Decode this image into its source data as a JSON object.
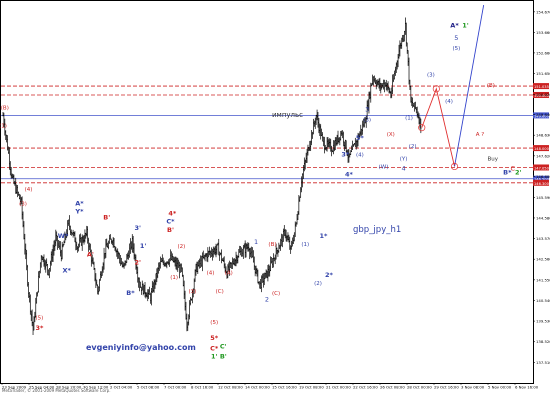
{
  "chart_data": {
    "type": "candlestick",
    "symbol_label": "gbp_jpy_h1",
    "email": "evgeniyinfo@yahoo.com",
    "footer": "MetaTrader, © 2001-2009 MetaQuotes Software Corp.",
    "impulse_label": "импульс",
    "buy_label": "Buy",
    "ylim": [
      136.5,
      155.2
    ],
    "price_ticks": [
      {
        "text": "154.670",
        "value": 154.67
      },
      {
        "text": "153.660",
        "value": 153.66
      },
      {
        "text": "152.660",
        "value": 152.66
      },
      {
        "text": "151.650",
        "value": 151.65
      },
      {
        "text": "150.620",
        "value": 150.62
      },
      {
        "text": "149.640",
        "value": 149.64
      },
      {
        "text": "148.630",
        "value": 148.63
      },
      {
        "text": "147.620",
        "value": 147.62
      },
      {
        "text": "146.600",
        "value": 146.6
      },
      {
        "text": "145.590",
        "value": 145.59
      },
      {
        "text": "144.580",
        "value": 144.58
      },
      {
        "text": "143.570",
        "value": 143.57
      },
      {
        "text": "142.560",
        "value": 142.56
      },
      {
        "text": "141.550",
        "value": 141.55
      },
      {
        "text": "140.540",
        "value": 140.54
      },
      {
        "text": "139.530",
        "value": 139.53
      },
      {
        "text": "138.520",
        "value": 138.52
      },
      {
        "text": "137.510",
        "value": 137.51
      }
    ],
    "levels": [
      {
        "text": "151.035",
        "value": 151.035,
        "color": "#cc2222",
        "style": "dashed"
      },
      {
        "text": "150.600",
        "value": 150.6,
        "color": "#cc2222",
        "style": "dashed"
      },
      {
        "text": "149.600",
        "value": 149.6,
        "color": "#4455cc",
        "style": "solid"
      },
      {
        "text": "148.000",
        "value": 148.0,
        "color": "#cc2222",
        "style": "dashed"
      },
      {
        "text": "147.050",
        "value": 147.05,
        "color": "#cc2222",
        "style": "dashed"
      },
      {
        "text": "146.500",
        "value": 146.5,
        "color": "#4455cc",
        "style": "solid"
      },
      {
        "text": "146.300",
        "value": 146.3,
        "color": "#cc2222",
        "style": "dashed"
      }
    ],
    "date_labels": [
      "23 Sep 2009",
      "25 Sep 04:00",
      "28 Sep 20:00",
      "30 Sep 12:00",
      "2 Oct 04:00",
      "5 Oct 08:00",
      "7 Oct 00:00",
      "8 Oct 16:00",
      "12 Oct 08:00",
      "14 Oct 00:00",
      "15 Oct 16:00",
      "19 Oct 08:00",
      "21 Oct 00:00",
      "22 Oct 16:00",
      "26 Oct 08:00",
      "28 Oct 00:00",
      "29 Oct 16:00",
      "3 Nov 08:00",
      "5 Nov 00:00",
      "6 Nov 16:00"
    ],
    "price_path": [
      {
        "bar": 0,
        "price": 149.6
      },
      {
        "bar": 10,
        "price": 146.5
      },
      {
        "bar": 20,
        "price": 145.3
      },
      {
        "bar": 28,
        "price": 141.0
      },
      {
        "bar": 33,
        "price": 139.1
      },
      {
        "bar": 42,
        "price": 142.8
      },
      {
        "bar": 50,
        "price": 142.0
      },
      {
        "bar": 58,
        "price": 143.6
      },
      {
        "bar": 64,
        "price": 142.8
      },
      {
        "bar": 72,
        "price": 144.3
      },
      {
        "bar": 82,
        "price": 143.2
      },
      {
        "bar": 92,
        "price": 143.8
      },
      {
        "bar": 104,
        "price": 141.0
      },
      {
        "bar": 112,
        "price": 143.0
      },
      {
        "bar": 120,
        "price": 143.6
      },
      {
        "bar": 132,
        "price": 142.1
      },
      {
        "bar": 142,
        "price": 143.4
      },
      {
        "bar": 150,
        "price": 141.3
      },
      {
        "bar": 162,
        "price": 140.7
      },
      {
        "bar": 172,
        "price": 142.3
      },
      {
        "bar": 184,
        "price": 142.6
      },
      {
        "bar": 196,
        "price": 142.0
      },
      {
        "bar": 202,
        "price": 139.4
      },
      {
        "bar": 212,
        "price": 142.1
      },
      {
        "bar": 224,
        "price": 142.8
      },
      {
        "bar": 236,
        "price": 143.1
      },
      {
        "bar": 246,
        "price": 141.9
      },
      {
        "bar": 258,
        "price": 142.8
      },
      {
        "bar": 270,
        "price": 143.2
      },
      {
        "bar": 282,
        "price": 141.3
      },
      {
        "bar": 292,
        "price": 142.0
      },
      {
        "bar": 300,
        "price": 142.9
      },
      {
        "bar": 310,
        "price": 143.9
      },
      {
        "bar": 316,
        "price": 143.0
      },
      {
        "bar": 322,
        "price": 144.3
      },
      {
        "bar": 328,
        "price": 146.5
      },
      {
        "bar": 336,
        "price": 148.1
      },
      {
        "bar": 344,
        "price": 149.6
      },
      {
        "bar": 352,
        "price": 148.2
      },
      {
        "bar": 362,
        "price": 148.0
      },
      {
        "bar": 372,
        "price": 148.8
      },
      {
        "bar": 380,
        "price": 147.5
      },
      {
        "bar": 388,
        "price": 148.3
      },
      {
        "bar": 398,
        "price": 149.4
      },
      {
        "bar": 406,
        "price": 151.5
      },
      {
        "bar": 414,
        "price": 151.0
      },
      {
        "bar": 420,
        "price": 151.2
      },
      {
        "bar": 426,
        "price": 150.6
      },
      {
        "bar": 434,
        "price": 152.6
      },
      {
        "bar": 442,
        "price": 154.0
      },
      {
        "bar": 448,
        "price": 150.2
      },
      {
        "bar": 454,
        "price": 149.9
      },
      {
        "bar": 460,
        "price": 149.0
      }
    ],
    "projection_red": [
      {
        "bar": 460,
        "price": 149.0
      },
      {
        "bar": 476,
        "price": 150.9
      },
      {
        "bar": 496,
        "price": 147.1
      }
    ],
    "projection_blue": [
      {
        "bar": 496,
        "price": 147.1
      },
      {
        "bar": 528,
        "price": 155.0
      }
    ],
    "annotations": [
      {
        "text": "(B)",
        "bar": 2,
        "price": 149.9,
        "color": "#cc2222"
      },
      {
        "text": "(1)",
        "bar": 0,
        "price": 149.0,
        "color": "#cc2222"
      },
      {
        "text": "(4)",
        "bar": 28,
        "price": 145.9,
        "color": "#cc2222"
      },
      {
        "text": "(3)",
        "bar": 22,
        "price": 145.2,
        "color": "#cc2222"
      },
      {
        "text": "(5)",
        "bar": 40,
        "price": 139.6,
        "color": "#cc2222"
      },
      {
        "text": "3*",
        "bar": 40,
        "price": 139.1,
        "color": "#cc2222"
      },
      {
        "text": "A*",
        "bar": 84,
        "price": 145.2,
        "color": "#3344aa"
      },
      {
        "text": "Y*",
        "bar": 84,
        "price": 144.8,
        "color": "#3344aa"
      },
      {
        "text": "W*",
        "bar": 66,
        "price": 143.6,
        "color": "#3344aa"
      },
      {
        "text": "B'",
        "bar": 114,
        "price": 144.5,
        "color": "#cc2222"
      },
      {
        "text": "A'",
        "bar": 96,
        "price": 142.7,
        "color": "#cc2222"
      },
      {
        "text": "X*",
        "bar": 70,
        "price": 141.9,
        "color": "#3344aa"
      },
      {
        "text": "B*",
        "bar": 140,
        "price": 140.8,
        "color": "#3344aa"
      },
      {
        "text": "1'",
        "bar": 154,
        "price": 143.1,
        "color": "#3344aa"
      },
      {
        "text": "2'",
        "bar": 148,
        "price": 142.3,
        "color": "#cc2222"
      },
      {
        "text": "3'",
        "bar": 148,
        "price": 144.0,
        "color": "#3344aa"
      },
      {
        "text": "4*",
        "bar": 186,
        "price": 144.7,
        "color": "#cc2222"
      },
      {
        "text": "C*",
        "bar": 184,
        "price": 144.3,
        "color": "#3344aa"
      },
      {
        "text": "B'",
        "bar": 184,
        "price": 143.9,
        "color": "#cc2222"
      },
      {
        "text": "(2)",
        "bar": 196,
        "price": 143.1,
        "color": "#cc2222"
      },
      {
        "text": "(1)",
        "bar": 188,
        "price": 141.6,
        "color": "#cc2222"
      },
      {
        "text": "(3)",
        "bar": 208,
        "price": 140.9,
        "color": "#cc2222"
      },
      {
        "text": "(4)",
        "bar": 228,
        "price": 141.8,
        "color": "#cc2222"
      },
      {
        "text": "(5)",
        "bar": 232,
        "price": 139.4,
        "color": "#cc2222"
      },
      {
        "text": "5*",
        "bar": 232,
        "price": 138.6,
        "color": "#cc2222"
      },
      {
        "text": "C*",
        "bar": 232,
        "price": 138.1,
        "color": "#cc2222"
      },
      {
        "text": "C'",
        "bar": 242,
        "price": 138.2,
        "color": "#229922"
      },
      {
        "text": "1'",
        "bar": 232,
        "price": 137.7,
        "color": "#229922"
      },
      {
        "text": "B'",
        "bar": 242,
        "price": 137.7,
        "color": "#229922"
      },
      {
        "text": "(C)",
        "bar": 238,
        "price": 140.9,
        "color": "#cc2222"
      },
      {
        "text": "(A)",
        "bar": 248,
        "price": 141.8,
        "color": "#cc2222"
      },
      {
        "text": "1",
        "bar": 278,
        "price": 143.3,
        "color": "#3344aa"
      },
      {
        "text": "(B)",
        "bar": 296,
        "price": 143.2,
        "color": "#cc2222"
      },
      {
        "text": "(C)",
        "bar": 300,
        "price": 140.8,
        "color": "#cc2222"
      },
      {
        "text": "2",
        "bar": 290,
        "price": 140.5,
        "color": "#3344aa"
      },
      {
        "text": "(1)",
        "bar": 332,
        "price": 143.2,
        "color": "#3344aa"
      },
      {
        "text": "(2)",
        "bar": 346,
        "price": 141.3,
        "color": "#3344aa"
      },
      {
        "text": "1*",
        "bar": 352,
        "price": 143.6,
        "color": "#3344aa"
      },
      {
        "text": "2*",
        "bar": 358,
        "price": 141.7,
        "color": "#3344aa"
      },
      {
        "text": "3*",
        "bar": 376,
        "price": 147.6,
        "color": "#3344aa"
      },
      {
        "text": "4*",
        "bar": 380,
        "price": 146.6,
        "color": "#3344aa"
      },
      {
        "text": "3",
        "bar": 400,
        "price": 149.8,
        "color": "#3344aa"
      },
      {
        "text": "(3)",
        "bar": 400,
        "price": 149.3,
        "color": "#3344aa"
      },
      {
        "text": "5*",
        "bar": 392,
        "price": 148.4,
        "color": "#3344aa"
      },
      {
        "text": "(4)",
        "bar": 392,
        "price": 147.6,
        "color": "#3344aa"
      },
      {
        "text": "(W)",
        "bar": 418,
        "price": 147.0,
        "color": "#3344aa"
      },
      {
        "text": "(X)",
        "bar": 426,
        "price": 148.6,
        "color": "#cc2222"
      },
      {
        "text": "(Y)",
        "bar": 440,
        "price": 147.4,
        "color": "#3344aa"
      },
      {
        "text": "4",
        "bar": 440,
        "price": 146.9,
        "color": "#3344aa"
      },
      {
        "text": "(2)",
        "bar": 450,
        "price": 148.0,
        "color": "#3344aa"
      },
      {
        "text": "(1)",
        "bar": 446,
        "price": 149.4,
        "color": "#3344aa"
      },
      {
        "text": "(3)",
        "bar": 470,
        "price": 151.5,
        "color": "#3344aa"
      },
      {
        "text": "(4)",
        "bar": 490,
        "price": 150.2,
        "color": "#3344aa"
      },
      {
        "text": "(5)",
        "bar": 498,
        "price": 152.8,
        "color": "#3344aa"
      },
      {
        "text": "5",
        "bar": 498,
        "price": 153.3,
        "color": "#3344aa"
      },
      {
        "text": "A*",
        "bar": 496,
        "price": 153.9,
        "color": "#222288"
      },
      {
        "text": "1'",
        "bar": 508,
        "price": 153.9,
        "color": "#229922"
      },
      {
        "text": "A ?",
        "bar": 524,
        "price": 148.6,
        "color": "#cc2222"
      },
      {
        "text": "(B)",
        "bar": 536,
        "price": 151.0,
        "color": "#cc2222"
      },
      {
        "text": "C",
        "bar": 560,
        "price": 146.9,
        "color": "#cc2222"
      },
      {
        "text": "B*",
        "bar": 554,
        "price": 146.7,
        "color": "#3344aa"
      },
      {
        "text": "2'",
        "bar": 566,
        "price": 146.7,
        "color": "#229922"
      },
      {
        "text": "Buy",
        "bar": 538,
        "price": 147.4,
        "color": "#333333"
      }
    ],
    "xlabel": "",
    "ylabel": ""
  }
}
